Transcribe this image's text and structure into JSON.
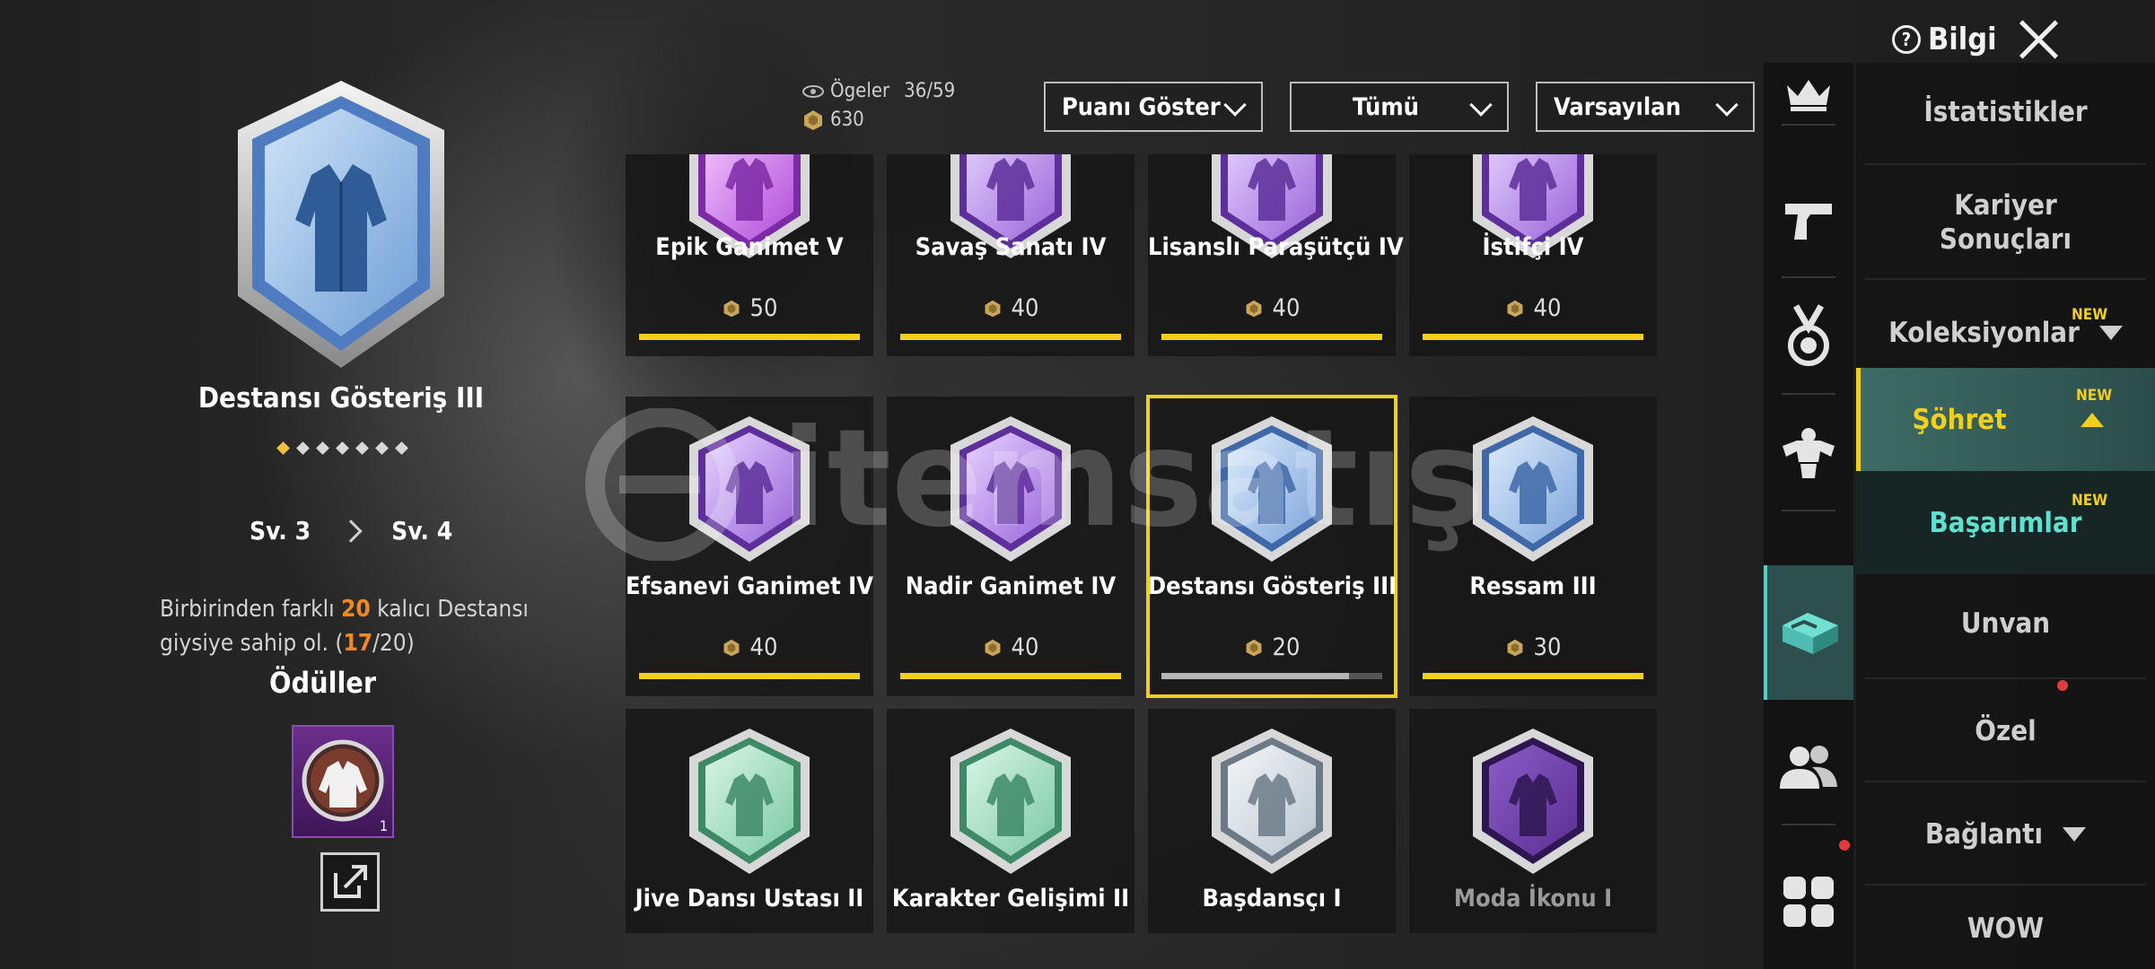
{
  "header": {
    "info_label": "Bilgi",
    "stats_items_label": "Ögeler",
    "stats_items_value": "36/59",
    "stats_points_value": "630",
    "filters": [
      "Puanı Göster",
      "Tümü",
      "Varsayılan"
    ]
  },
  "detail": {
    "title": "Destansı Gösteriş III",
    "stars_total": 7,
    "stars_filled": 1,
    "level_from": "Sv. 3",
    "level_to": "Sv. 4",
    "desc_part1": "Birbirinden farklı ",
    "desc_highlight": "20",
    "desc_part2": " kalıcı Destansı giysiye sahip ol. (",
    "desc_progress": "17",
    "desc_part3": "/20)",
    "rewards_label": "Ödüller",
    "reward_qty": "1"
  },
  "grid": {
    "cards": [
      {
        "name": "Epik Ganimet V",
        "points": "50",
        "progress": 1.0,
        "badge": "purple-pink"
      },
      {
        "name": "Savaş Sanatı IV",
        "points": "40",
        "progress": 1.0,
        "badge": "purple"
      },
      {
        "name": "Lisanslı Paraşütçü IV",
        "points": "40",
        "progress": 1.0,
        "badge": "purple"
      },
      {
        "name": "İstifçi IV",
        "points": "40",
        "progress": 1.0,
        "badge": "purple"
      },
      {
        "name": "Efsanevi Ganimet IV",
        "points": "40",
        "progress": 1.0,
        "badge": "purple"
      },
      {
        "name": "Nadir Ganimet IV",
        "points": "40",
        "progress": 1.0,
        "badge": "purple"
      },
      {
        "name": "Destansı Gösteriş III",
        "points": "20",
        "progress": 0.85,
        "badge": "blue",
        "selected": true
      },
      {
        "name": "Ressam III",
        "points": "30",
        "progress": 1.0,
        "badge": "blue"
      },
      {
        "name": "Jive Dansı Ustası II",
        "badge": "green"
      },
      {
        "name": "Karakter Gelişimi II",
        "badge": "green"
      },
      {
        "name": "Başdansçı I",
        "badge": "silver"
      },
      {
        "name": "Moda İkonu I",
        "badge": "dark-purple",
        "locked": true
      }
    ]
  },
  "menu": {
    "items": [
      {
        "label": "İstatistikler"
      },
      {
        "label": "Kariyer Sonuçları"
      },
      {
        "label": "Koleksiyonlar",
        "new": "NEW"
      },
      {
        "label": "Şöhret",
        "new": "NEW"
      },
      {
        "label": "Başarımlar",
        "new": "NEW"
      },
      {
        "label": "Unvan"
      },
      {
        "label": "Özel"
      },
      {
        "label": "Bağlantı"
      },
      {
        "label": "WOW"
      }
    ]
  },
  "icons": [
    "crown-icon",
    "pistol-icon",
    "medal-icon",
    "muscle-icon",
    "box-icon",
    "friends-icon",
    "grid-icon"
  ],
  "colors": {
    "accent_yellow": "#f2cf1c",
    "accent_teal": "#4fd1c5",
    "highlight_orange": "#f08a1c"
  }
}
